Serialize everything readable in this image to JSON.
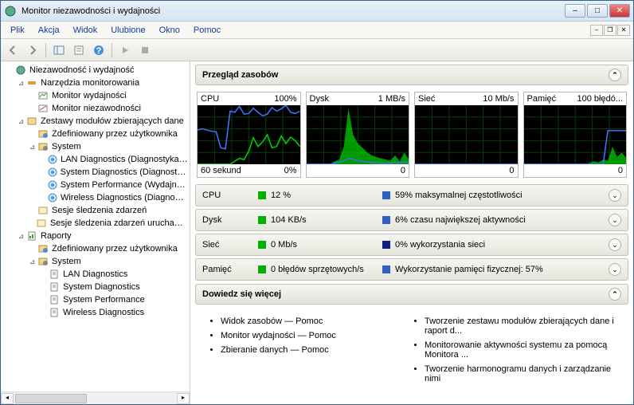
{
  "window": {
    "title": "Monitor niezawodności i wydajności"
  },
  "menus": [
    "Plik",
    "Akcja",
    "Widok",
    "Ulubione",
    "Okno",
    "Pomoc"
  ],
  "tree": [
    {
      "depth": 0,
      "exp": "",
      "icon": "monitor",
      "label": "Niezawodność i wydajność"
    },
    {
      "depth": 1,
      "exp": "⊿",
      "icon": "tools",
      "label": "Narzędzia monitorowania"
    },
    {
      "depth": 2,
      "exp": "",
      "icon": "perf",
      "label": "Monitor wydajności"
    },
    {
      "depth": 2,
      "exp": "",
      "icon": "rel",
      "label": "Monitor niezawodności"
    },
    {
      "depth": 1,
      "exp": "⊿",
      "icon": "dcs",
      "label": "Zestawy modułów zbierających dane"
    },
    {
      "depth": 2,
      "exp": "",
      "icon": "user",
      "label": "Zdefiniowany przez użytkownika"
    },
    {
      "depth": 2,
      "exp": "⊿",
      "icon": "sys",
      "label": "System"
    },
    {
      "depth": 3,
      "exp": "",
      "icon": "diag",
      "label": "LAN Diagnostics (Diagnostyka sieci l"
    },
    {
      "depth": 3,
      "exp": "",
      "icon": "diag",
      "label": "System Diagnostics (Diagnostyka sys"
    },
    {
      "depth": 3,
      "exp": "",
      "icon": "diag",
      "label": "System Performance (Wydajność sys"
    },
    {
      "depth": 3,
      "exp": "",
      "icon": "diag",
      "label": "Wireless Diagnostics (Diagnostyka si"
    },
    {
      "depth": 2,
      "exp": "",
      "icon": "trace",
      "label": "Sesje śledzenia zdarzeń"
    },
    {
      "depth": 2,
      "exp": "",
      "icon": "trace",
      "label": "Sesje śledzenia zdarzeń uruchamiania"
    },
    {
      "depth": 1,
      "exp": "⊿",
      "icon": "report",
      "label": "Raporty"
    },
    {
      "depth": 2,
      "exp": "",
      "icon": "user",
      "label": "Zdefiniowany przez użytkownika"
    },
    {
      "depth": 2,
      "exp": "⊿",
      "icon": "sys",
      "label": "System"
    },
    {
      "depth": 3,
      "exp": "",
      "icon": "rpt",
      "label": "LAN Diagnostics"
    },
    {
      "depth": 3,
      "exp": "",
      "icon": "rpt",
      "label": "System Diagnostics"
    },
    {
      "depth": 3,
      "exp": "",
      "icon": "rpt",
      "label": "System Performance"
    },
    {
      "depth": 3,
      "exp": "",
      "icon": "rpt",
      "label": "Wireless Diagnostics"
    }
  ],
  "overview_title": "Przegląd zasobów",
  "charts_row": [
    {
      "name": "CPU",
      "max": "100%",
      "zero": "0%",
      "timelabel": "60 sekund"
    },
    {
      "name": "Dysk",
      "max": "1 MB/s",
      "zero": "0",
      "timelabel": ""
    },
    {
      "name": "Sieć",
      "max": "10 Mb/s",
      "zero": "0",
      "timelabel": ""
    },
    {
      "name": "Pamięć",
      "max": "100 błędó...",
      "zero": "0",
      "timelabel": ""
    }
  ],
  "metrics": [
    {
      "name": "CPU",
      "c1": "#00b000",
      "val": "12 %",
      "c2": "#3060c0",
      "desc": "59% maksymalnej częstotliwości"
    },
    {
      "name": "Dysk",
      "c1": "#00b000",
      "val": "104 KB/s",
      "c2": "#3060c0",
      "desc": "6% czasu największej aktywności"
    },
    {
      "name": "Sieć",
      "c1": "#00b000",
      "val": "0 Mb/s",
      "c2": "#102080",
      "desc": "0% wykorzystania sieci"
    },
    {
      "name": "Pamięć",
      "c1": "#00b000",
      "val": "0 błędów sprzętowych/s",
      "c2": "#3060c0",
      "desc": "Wykorzystanie pamięci fizycznej: 57%"
    }
  ],
  "learnmore_title": "Dowiedz się więcej",
  "learn_left": [
    "Widok zasobów — Pomoc",
    "Monitor wydajności — Pomoc",
    "Zbieranie danych — Pomoc"
  ],
  "learn_right": [
    "Tworzenie zestawu modułów zbierających dane i raport d...",
    "Monitorowanie aktywności systemu za pomocą Monitora ...",
    "Tworzenie harmonogramu danych i zarządzanie nimi"
  ],
  "chart_data": [
    {
      "type": "line",
      "title": "CPU",
      "ylim": [
        0,
        100
      ],
      "x_seconds": 60,
      "series": [
        {
          "name": "freq",
          "color": "#4070ff",
          "values": [
            58,
            60,
            58,
            56,
            55,
            28,
            26,
            90,
            88,
            98,
            85,
            86,
            95,
            88,
            82,
            85,
            96,
            90,
            94,
            100,
            88,
            86,
            90
          ]
        },
        {
          "name": "usage",
          "color": "#00d000",
          "values": [
            0,
            0,
            0,
            0,
            0,
            0,
            0,
            0,
            5,
            10,
            8,
            22,
            45,
            30,
            38,
            50,
            28,
            30,
            48,
            35,
            46,
            40,
            30
          ]
        }
      ]
    },
    {
      "type": "line",
      "title": "Dysk",
      "ylim": [
        0,
        1
      ],
      "x_seconds": 60,
      "series": [
        {
          "name": "throughput",
          "color": "#00d000",
          "values": [
            0,
            0,
            0,
            0,
            0,
            0,
            0.05,
            0.08,
            0.3,
            0.95,
            0.5,
            0.35,
            0.28,
            0.2,
            0.15,
            0.12,
            0.1,
            0.08,
            0.06,
            0.15,
            0.05,
            0.2,
            0.08
          ]
        },
        {
          "name": "active",
          "color": "#4070ff",
          "values": [
            0,
            0,
            0,
            0,
            0,
            0,
            0.02,
            0.03,
            0.06,
            0.1,
            0.08,
            0.06,
            0.05,
            0.04,
            0.03,
            0.03,
            0.02,
            0.02,
            0.02,
            0.03,
            0.02,
            0.04,
            0.02
          ]
        }
      ]
    },
    {
      "type": "line",
      "title": "Sieć",
      "ylim": [
        0,
        10
      ],
      "x_seconds": 60,
      "series": [
        {
          "name": "throughput",
          "color": "#00d000",
          "values": [
            0,
            0,
            0,
            0,
            0,
            0,
            0,
            0,
            0,
            0,
            0,
            0,
            0,
            0,
            0,
            0,
            0,
            0,
            0,
            0,
            0,
            0,
            0
          ]
        },
        {
          "name": "util",
          "color": "#4070ff",
          "values": [
            0,
            0,
            0,
            0,
            0,
            0,
            0,
            0,
            0,
            0,
            0,
            0,
            0,
            0,
            0,
            0,
            0,
            0,
            0,
            0,
            0,
            0,
            0
          ]
        }
      ]
    },
    {
      "type": "line",
      "title": "Pamięć",
      "ylim": [
        0,
        100
      ],
      "x_seconds": 60,
      "series": [
        {
          "name": "faults",
          "color": "#00d000",
          "values": [
            0,
            0,
            0,
            0,
            0,
            0,
            0,
            0,
            0,
            0,
            0,
            0,
            0,
            0,
            2,
            5,
            3,
            8,
            6,
            30,
            12,
            20,
            10
          ]
        },
        {
          "name": "phys",
          "color": "#4070ff",
          "values": [
            0,
            0,
            0,
            0,
            0,
            0,
            0,
            0,
            0,
            0,
            0,
            0,
            0,
            0,
            0,
            0,
            0,
            0,
            57,
            57,
            57,
            57,
            57
          ]
        }
      ]
    }
  ]
}
